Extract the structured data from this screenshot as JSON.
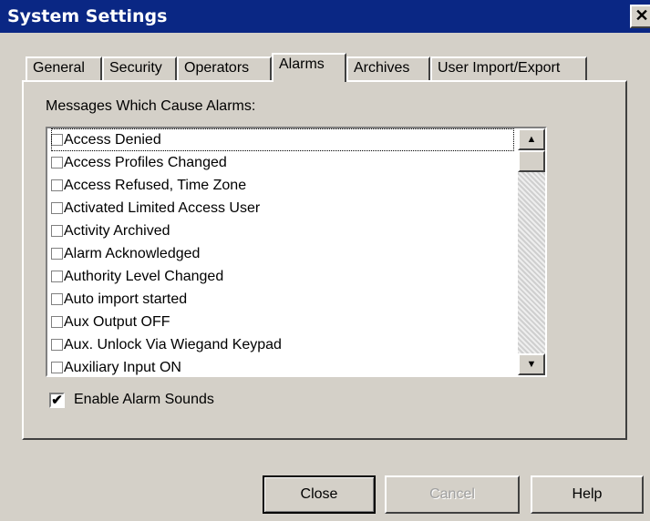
{
  "window": {
    "title": "System Settings",
    "close_glyph": "✕"
  },
  "tabs": [
    {
      "label": "General"
    },
    {
      "label": "Security"
    },
    {
      "label": "Operators"
    },
    {
      "label": "Alarms"
    },
    {
      "label": "Archives"
    },
    {
      "label": "User Import/Export"
    }
  ],
  "active_tab": "Alarms",
  "alarms": {
    "list_label": "Messages Which Cause Alarms:",
    "items": [
      {
        "label": "Access Denied",
        "checked": false
      },
      {
        "label": "Access Profiles Changed",
        "checked": false
      },
      {
        "label": "Access Refused, Time Zone",
        "checked": false
      },
      {
        "label": "Activated Limited Access User",
        "checked": false
      },
      {
        "label": "Activity Archived",
        "checked": false
      },
      {
        "label": "Alarm Acknowledged",
        "checked": false
      },
      {
        "label": "Authority Level Changed",
        "checked": false
      },
      {
        "label": "Auto import started",
        "checked": false
      },
      {
        "label": "Aux Output OFF",
        "checked": false
      },
      {
        "label": "Aux. Unlock Via Wiegand Keypad",
        "checked": false
      },
      {
        "label": "Auxiliary Input ON",
        "checked": false
      }
    ],
    "scroll_up_glyph": "▲",
    "scroll_down_glyph": "▼",
    "enable_sounds": {
      "label": "Enable Alarm Sounds",
      "checked": true,
      "check_glyph": "✔"
    }
  },
  "buttons": {
    "close": "Close",
    "cancel": "Cancel",
    "help": "Help"
  },
  "icons": [
    "close-icon",
    "scroll-up-arrow-icon",
    "scroll-down-arrow-icon",
    "checkmark-icon"
  ]
}
